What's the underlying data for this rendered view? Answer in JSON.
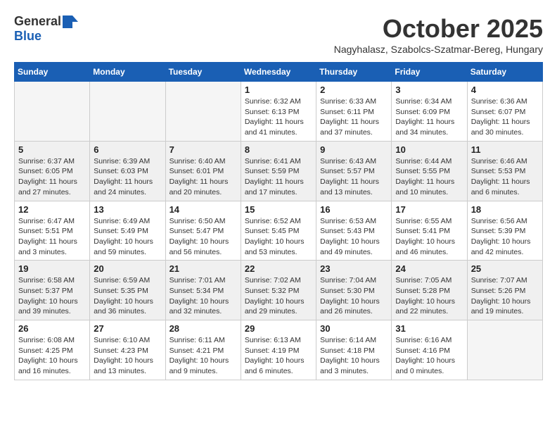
{
  "header": {
    "logo_general": "General",
    "logo_blue": "Blue",
    "title": "October 2025",
    "subtitle": "Nagyhalasz, Szabolcs-Szatmar-Bereg, Hungary"
  },
  "days_of_week": [
    "Sunday",
    "Monday",
    "Tuesday",
    "Wednesday",
    "Thursday",
    "Friday",
    "Saturday"
  ],
  "weeks": [
    [
      {
        "day": "",
        "info": ""
      },
      {
        "day": "",
        "info": ""
      },
      {
        "day": "",
        "info": ""
      },
      {
        "day": "1",
        "info": "Sunrise: 6:32 AM\nSunset: 6:13 PM\nDaylight: 11 hours\nand 41 minutes."
      },
      {
        "day": "2",
        "info": "Sunrise: 6:33 AM\nSunset: 6:11 PM\nDaylight: 11 hours\nand 37 minutes."
      },
      {
        "day": "3",
        "info": "Sunrise: 6:34 AM\nSunset: 6:09 PM\nDaylight: 11 hours\nand 34 minutes."
      },
      {
        "day": "4",
        "info": "Sunrise: 6:36 AM\nSunset: 6:07 PM\nDaylight: 11 hours\nand 30 minutes."
      }
    ],
    [
      {
        "day": "5",
        "info": "Sunrise: 6:37 AM\nSunset: 6:05 PM\nDaylight: 11 hours\nand 27 minutes."
      },
      {
        "day": "6",
        "info": "Sunrise: 6:39 AM\nSunset: 6:03 PM\nDaylight: 11 hours\nand 24 minutes."
      },
      {
        "day": "7",
        "info": "Sunrise: 6:40 AM\nSunset: 6:01 PM\nDaylight: 11 hours\nand 20 minutes."
      },
      {
        "day": "8",
        "info": "Sunrise: 6:41 AM\nSunset: 5:59 PM\nDaylight: 11 hours\nand 17 minutes."
      },
      {
        "day": "9",
        "info": "Sunrise: 6:43 AM\nSunset: 5:57 PM\nDaylight: 11 hours\nand 13 minutes."
      },
      {
        "day": "10",
        "info": "Sunrise: 6:44 AM\nSunset: 5:55 PM\nDaylight: 11 hours\nand 10 minutes."
      },
      {
        "day": "11",
        "info": "Sunrise: 6:46 AM\nSunset: 5:53 PM\nDaylight: 11 hours\nand 6 minutes."
      }
    ],
    [
      {
        "day": "12",
        "info": "Sunrise: 6:47 AM\nSunset: 5:51 PM\nDaylight: 11 hours\nand 3 minutes."
      },
      {
        "day": "13",
        "info": "Sunrise: 6:49 AM\nSunset: 5:49 PM\nDaylight: 10 hours\nand 59 minutes."
      },
      {
        "day": "14",
        "info": "Sunrise: 6:50 AM\nSunset: 5:47 PM\nDaylight: 10 hours\nand 56 minutes."
      },
      {
        "day": "15",
        "info": "Sunrise: 6:52 AM\nSunset: 5:45 PM\nDaylight: 10 hours\nand 53 minutes."
      },
      {
        "day": "16",
        "info": "Sunrise: 6:53 AM\nSunset: 5:43 PM\nDaylight: 10 hours\nand 49 minutes."
      },
      {
        "day": "17",
        "info": "Sunrise: 6:55 AM\nSunset: 5:41 PM\nDaylight: 10 hours\nand 46 minutes."
      },
      {
        "day": "18",
        "info": "Sunrise: 6:56 AM\nSunset: 5:39 PM\nDaylight: 10 hours\nand 42 minutes."
      }
    ],
    [
      {
        "day": "19",
        "info": "Sunrise: 6:58 AM\nSunset: 5:37 PM\nDaylight: 10 hours\nand 39 minutes."
      },
      {
        "day": "20",
        "info": "Sunrise: 6:59 AM\nSunset: 5:35 PM\nDaylight: 10 hours\nand 36 minutes."
      },
      {
        "day": "21",
        "info": "Sunrise: 7:01 AM\nSunset: 5:34 PM\nDaylight: 10 hours\nand 32 minutes."
      },
      {
        "day": "22",
        "info": "Sunrise: 7:02 AM\nSunset: 5:32 PM\nDaylight: 10 hours\nand 29 minutes."
      },
      {
        "day": "23",
        "info": "Sunrise: 7:04 AM\nSunset: 5:30 PM\nDaylight: 10 hours\nand 26 minutes."
      },
      {
        "day": "24",
        "info": "Sunrise: 7:05 AM\nSunset: 5:28 PM\nDaylight: 10 hours\nand 22 minutes."
      },
      {
        "day": "25",
        "info": "Sunrise: 7:07 AM\nSunset: 5:26 PM\nDaylight: 10 hours\nand 19 minutes."
      }
    ],
    [
      {
        "day": "26",
        "info": "Sunrise: 6:08 AM\nSunset: 4:25 PM\nDaylight: 10 hours\nand 16 minutes."
      },
      {
        "day": "27",
        "info": "Sunrise: 6:10 AM\nSunset: 4:23 PM\nDaylight: 10 hours\nand 13 minutes."
      },
      {
        "day": "28",
        "info": "Sunrise: 6:11 AM\nSunset: 4:21 PM\nDaylight: 10 hours\nand 9 minutes."
      },
      {
        "day": "29",
        "info": "Sunrise: 6:13 AM\nSunset: 4:19 PM\nDaylight: 10 hours\nand 6 minutes."
      },
      {
        "day": "30",
        "info": "Sunrise: 6:14 AM\nSunset: 4:18 PM\nDaylight: 10 hours\nand 3 minutes."
      },
      {
        "day": "31",
        "info": "Sunrise: 6:16 AM\nSunset: 4:16 PM\nDaylight: 10 hours\nand 0 minutes."
      },
      {
        "day": "",
        "info": ""
      }
    ]
  ]
}
